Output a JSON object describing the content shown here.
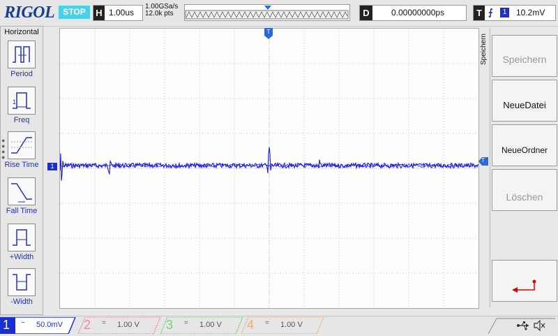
{
  "brand": "RIGOL",
  "run_state": "STOP",
  "horizontal": {
    "label": "H",
    "timebase": "1.00us"
  },
  "sample": {
    "rate": "1.00GSa/s",
    "points": "12.0k pts"
  },
  "delay": {
    "label": "D",
    "value": "0.00000000ps"
  },
  "trigger": {
    "label": "T",
    "edge_symbol": "⨍",
    "source": "1",
    "level": "10.2mV",
    "marker": "T"
  },
  "left_menu": {
    "title": "Horizontal",
    "items": [
      {
        "label": "Period",
        "icon": "period-icon"
      },
      {
        "label": "Freq",
        "icon": "freq-icon"
      },
      {
        "label": "Rise Time",
        "icon": "rise-time-icon"
      },
      {
        "label": "Fall Time",
        "icon": "fall-time-icon"
      },
      {
        "label": "+Width",
        "icon": "plus-width-icon"
      },
      {
        "label": "-Width",
        "icon": "minus-width-icon"
      }
    ]
  },
  "right_menu": {
    "title": "Speichern",
    "buttons": [
      {
        "label": "Speichern",
        "enabled": false
      },
      {
        "label": "NeueDatei",
        "enabled": true
      },
      {
        "label": "NeueOrdner",
        "enabled": true
      },
      {
        "label": "Löschen",
        "enabled": false
      }
    ],
    "back_icon": "return-arrow-icon"
  },
  "channels": [
    {
      "num": "1",
      "coupling": "~",
      "scale": "50.0mV",
      "color": "#1a2fd0",
      "active": true
    },
    {
      "num": "2",
      "coupling": "=",
      "scale": "1.00 V",
      "color": "#f08a9a",
      "active": false
    },
    {
      "num": "3",
      "coupling": "=",
      "scale": "1.00 V",
      "color": "#7ad07a",
      "active": false
    },
    {
      "num": "4",
      "coupling": "=",
      "scale": "1.00 V",
      "color": "#f0b070",
      "active": false
    }
  ],
  "channel1_marker": "1",
  "status_icons": [
    "usb-icon",
    "speaker-mute-icon"
  ],
  "colors": {
    "trace": "#1a1ae0",
    "accent": "#2030c0",
    "stop": "#4ad0e8"
  }
}
